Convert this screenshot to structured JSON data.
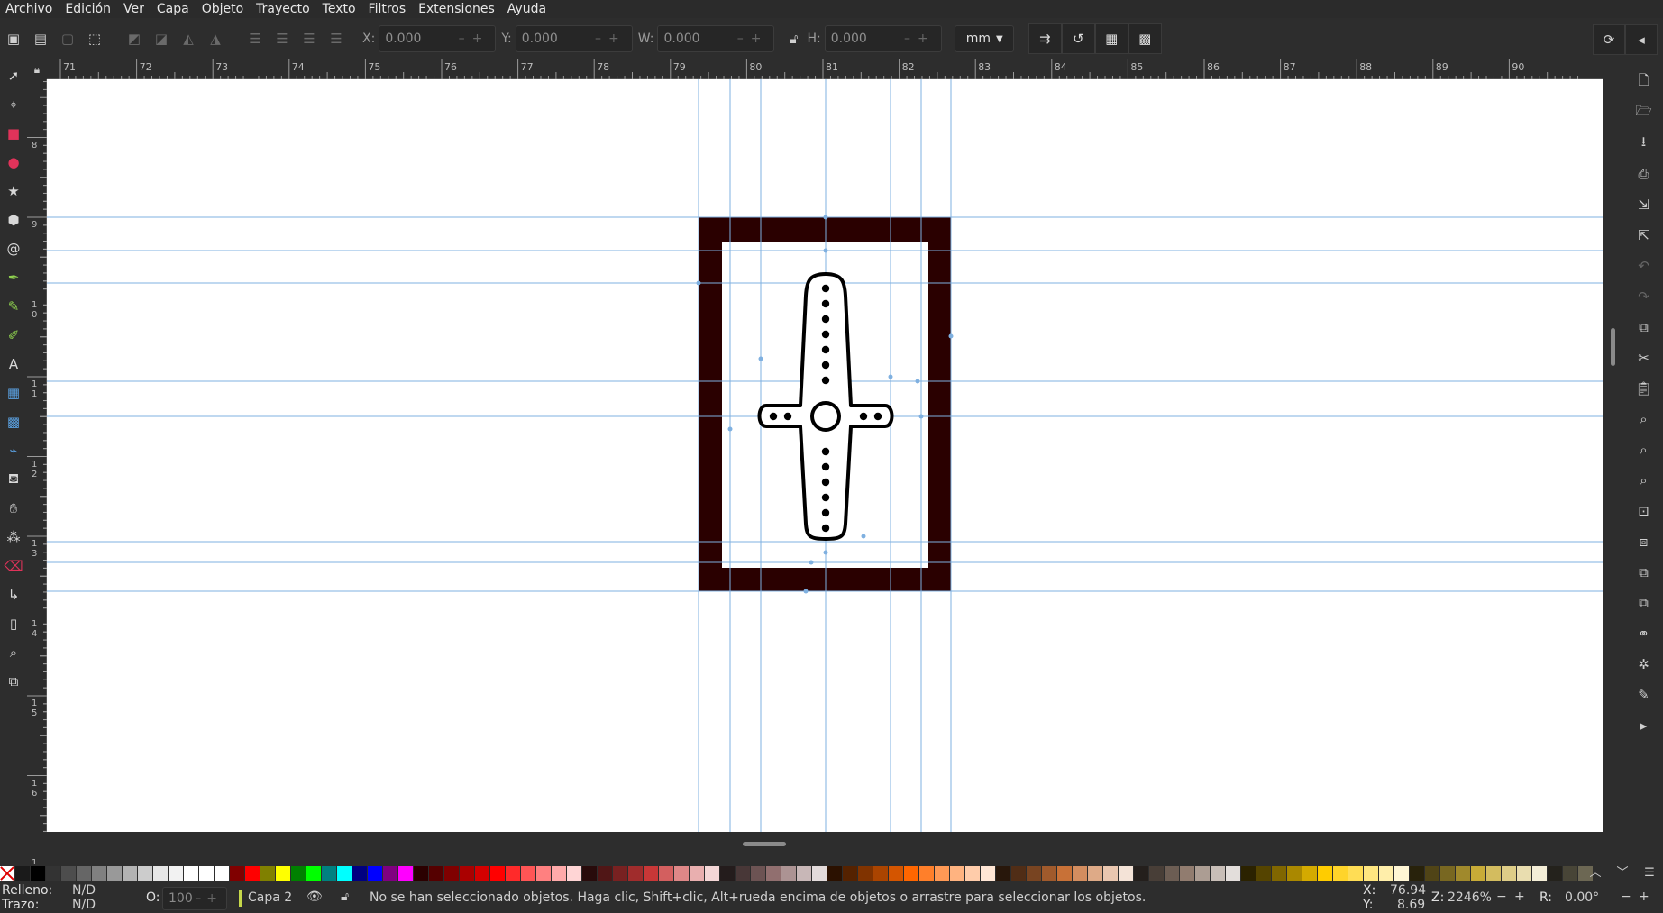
{
  "menu": [
    "Archivo",
    "Edición",
    "Ver",
    "Capa",
    "Objeto",
    "Trayecto",
    "Texto",
    "Filtros",
    "Extensiones",
    "Ayuda"
  ],
  "toolbar": {
    "x_label": "X:",
    "x_value": "0.000",
    "y_label": "Y:",
    "y_value": "0.000",
    "w_label": "W:",
    "w_value": "0.000",
    "h_label": "H:",
    "h_value": "0.000",
    "unit": "mm"
  },
  "ruler": {
    "h_ticks": [
      "71",
      "72",
      "73",
      "74",
      "75",
      "76",
      "77",
      "78",
      "79",
      "80",
      "81",
      "82",
      "83",
      "84",
      "85",
      "86",
      "87",
      "88",
      "89",
      "90"
    ],
    "v_ticks": [
      "8",
      "9",
      "1\n0",
      "1\n1",
      "1\n2",
      "1\n3",
      "1\n4",
      "1\n5",
      "1\n6",
      "1"
    ]
  },
  "tools": [
    "selector-tool",
    "node-tool",
    "rect-tool",
    "ellipse-tool",
    "star-tool",
    "3dbox-tool",
    "spiral-tool",
    "pen-tool",
    "pencil-tool",
    "calligraphy-tool",
    "text-tool",
    "gradient-tool",
    "mesh-tool",
    "dropper-tool",
    "paint-bucket-tool",
    "tweak-tool",
    "spray-tool",
    "eraser-tool",
    "connector-tool",
    "pages-tool",
    "zoom-tool",
    "measure-tool"
  ],
  "palette": [
    "#1a1a1a",
    "#000000",
    "#333333",
    "#4d4d4d",
    "#666666",
    "#808080",
    "#999999",
    "#b3b3b3",
    "#cccccc",
    "#e6e6e6",
    "#f2f2f2",
    "#ffffff",
    "#ffffff",
    "#ffffff",
    "#800000",
    "#ff0000",
    "#808000",
    "#ffff00",
    "#008000",
    "#00ff00",
    "#008080",
    "#00ffff",
    "#000080",
    "#0000ff",
    "#800080",
    "#ff00ff",
    "#2b0000",
    "#550000",
    "#800000",
    "#aa0000",
    "#d40000",
    "#ff0000",
    "#ff2a2a",
    "#ff5555",
    "#ff8080",
    "#ffaaaa",
    "#ffd5d5",
    "#280b0b",
    "#501616",
    "#782121",
    "#a02c2c",
    "#c83737",
    "#d35f5f",
    "#de8787",
    "#e9afaf",
    "#f4d7d7",
    "#241c1c",
    "#483737",
    "#6c5353",
    "#916f6f",
    "#ac9393",
    "#c8b7b7",
    "#e3dbdb",
    "#2b1100",
    "#552200",
    "#803300",
    "#aa4400",
    "#d45500",
    "#ff6600",
    "#ff7f2a",
    "#ff9955",
    "#ffb380",
    "#ffccaa",
    "#ffe6d5",
    "#28170b",
    "#502d16",
    "#784421",
    "#a05a2c",
    "#c87137",
    "#d38d5f",
    "#deaa87",
    "#e9c6af",
    "#f4e3d7",
    "#241f1c",
    "#483e37",
    "#6c5d53",
    "#917c6f",
    "#ac9d93",
    "#c8beb7",
    "#e3dedb",
    "#2b2200",
    "#554400",
    "#806600",
    "#aa8800",
    "#d4aa00",
    "#ffcc00",
    "#ffd42a",
    "#ffdd55",
    "#ffe680",
    "#ffeeaa",
    "#fff6d5",
    "#28220b",
    "#504416",
    "#786721",
    "#a0892c",
    "#c8ab37",
    "#d3bc5f",
    "#decd87",
    "#e9ddaf",
    "#f4eed7",
    "#24221c",
    "#484537",
    "#6c6753"
  ],
  "status": {
    "fill_label": "Relleno:",
    "fill_value": "N/D",
    "stroke_label": "Trazo:",
    "stroke_value": "N/D",
    "opacity_label": "O:",
    "opacity_value": "100",
    "layer": "Capa 2",
    "message": "No se han seleccionado objetos. Haga clic, Shift+clic, Alt+rueda encima de objetos o arrastre para seleccionar los objetos.",
    "x_label": "X:",
    "x_value": "76.94",
    "y_label": "Y:",
    "y_value": "8.69",
    "zoom_label": "Z:",
    "zoom_value": "2246%",
    "rotation_label": "R:",
    "rotation_value": "0.00°"
  },
  "canvas": {
    "frame_color": "#2a0000",
    "guide_color": "#7fb0e0"
  }
}
